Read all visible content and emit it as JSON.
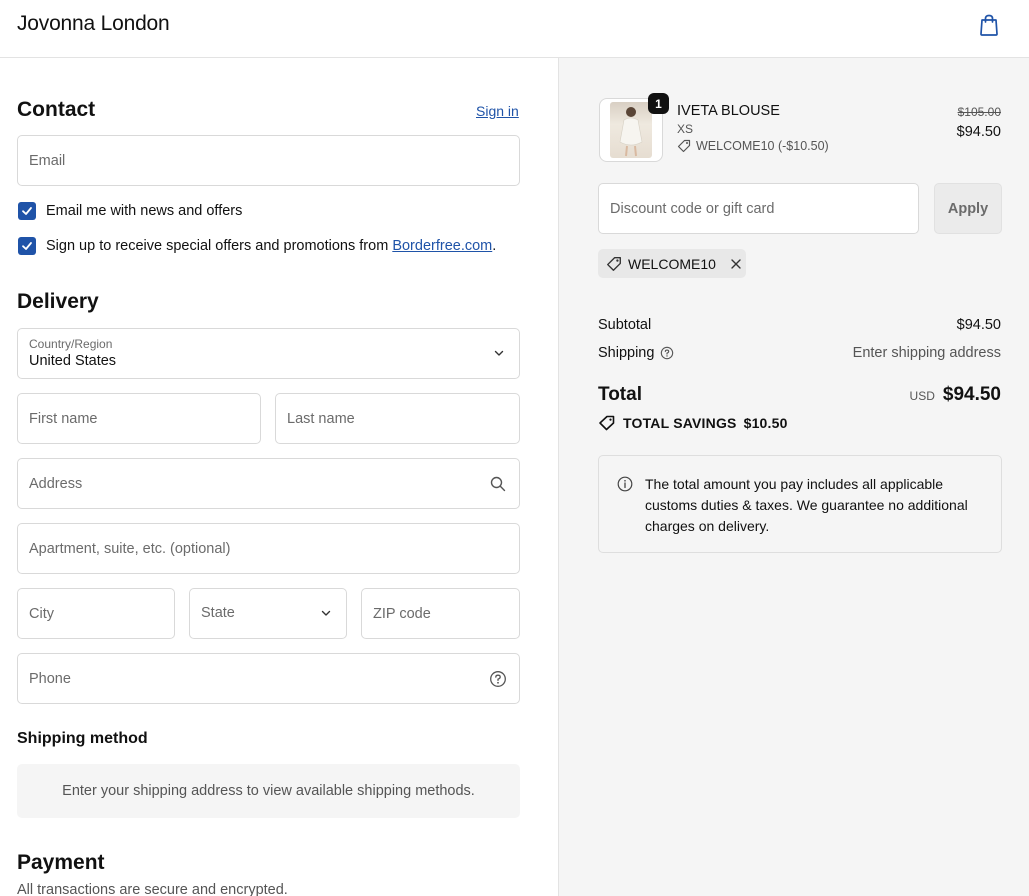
{
  "header": {
    "brand": "Jovonna London",
    "cart_icon": "shopping-bag-icon"
  },
  "contact": {
    "title": "Contact",
    "sign_in": "Sign in",
    "email_placeholder": "Email",
    "news_checkbox": {
      "label": "Email me with news and offers",
      "checked": true
    },
    "promo_checkbox": {
      "label_prefix": "Sign up to receive special offers and promotions from ",
      "link": "Borderfree.com",
      "label_suffix": ".",
      "checked": true
    }
  },
  "delivery": {
    "title": "Delivery",
    "country": {
      "label": "Country/Region",
      "value": "United States"
    },
    "first_name": "First name",
    "last_name": "Last name",
    "address": "Address",
    "apartment": "Apartment, suite, etc. (optional)",
    "city": "City",
    "state": "State",
    "zip": "ZIP code",
    "phone": "Phone"
  },
  "shipping_method": {
    "title": "Shipping method",
    "message": "Enter your shipping address to view available shipping methods."
  },
  "payment": {
    "title": "Payment",
    "subtitle": "All transactions are secure and encrypted."
  },
  "summary": {
    "item": {
      "name": "IVETA BLOUSE",
      "variant": "XS",
      "quantity": "1",
      "discount_label": "WELCOME10 (-$10.50)",
      "original_price": "$105.00",
      "price": "$94.50"
    },
    "discount_placeholder": "Discount code or gift card",
    "apply_label": "Apply",
    "applied_code": "WELCOME10",
    "subtotal_label": "Subtotal",
    "subtotal_value": "$94.50",
    "shipping_label": "Shipping",
    "shipping_value": "Enter shipping address",
    "total_label": "Total",
    "currency": "USD",
    "total_value": "$94.50",
    "savings_label": "TOTAL SAVINGS",
    "savings_value": "$10.50",
    "notice": "The total amount you pay includes all applicable customs duties & taxes. We guarantee no additional charges on delivery."
  },
  "colors": {
    "accent": "#1f53a8",
    "summary_bg": "#f5f5f5",
    "border": "#d9d9d9"
  }
}
